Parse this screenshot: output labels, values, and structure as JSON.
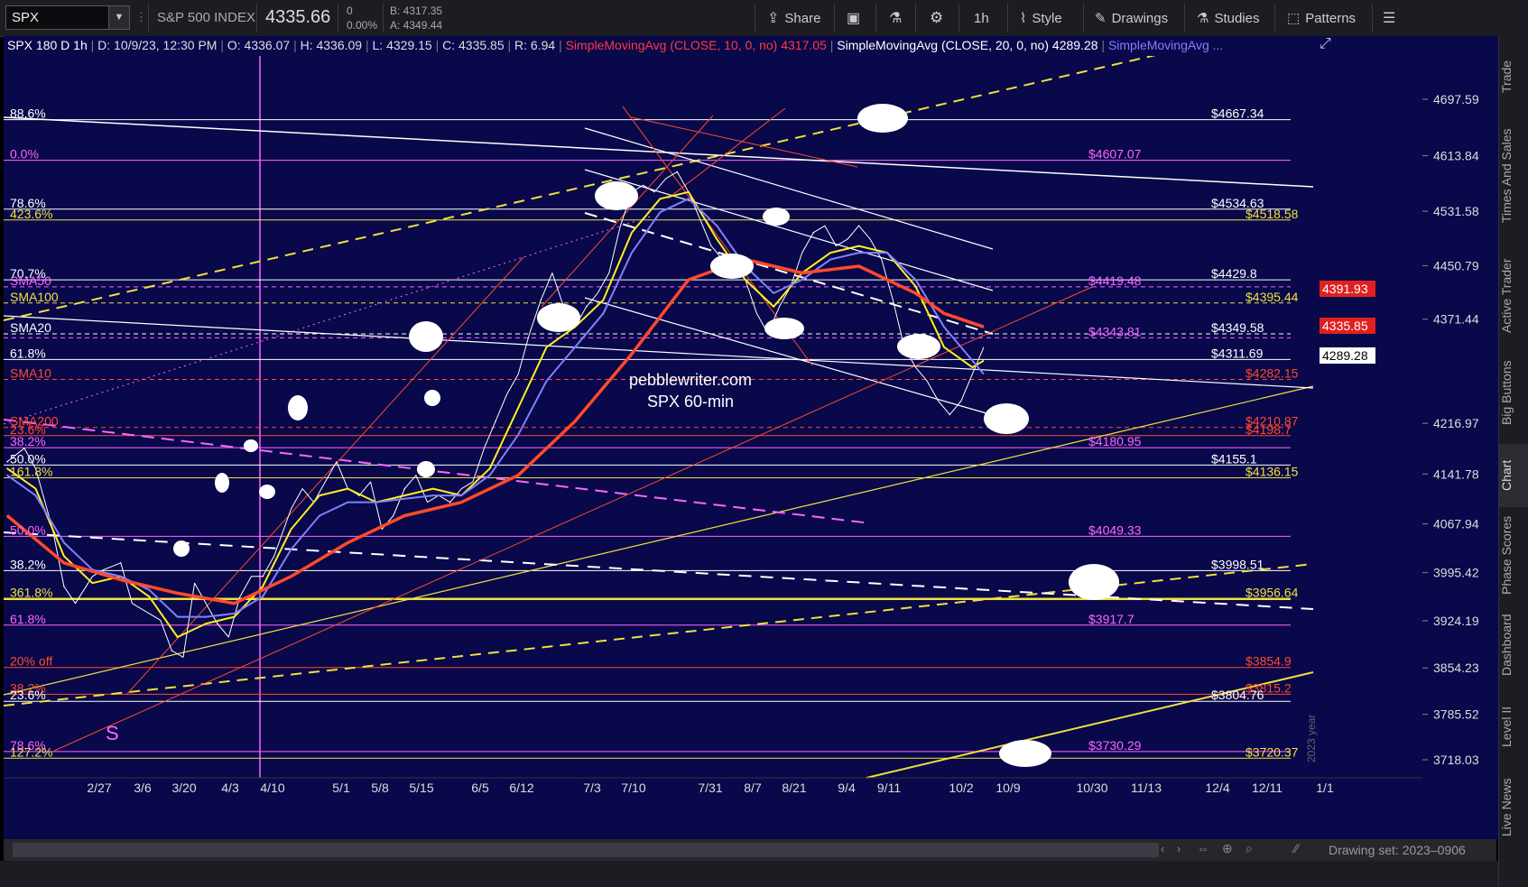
{
  "toolbar": {
    "symbol": "SPX",
    "dropdown": "▼",
    "name": "S&P 500 INDEX",
    "last": "4335.66",
    "change": "0",
    "change_pct": "0.00%",
    "bid": "B: 4317.35",
    "ask": "A: 4349.44",
    "share": "Share",
    "interval": "1h",
    "style": "Style",
    "drawings": "Drawings",
    "studies": "Studies",
    "patterns": "Patterns"
  },
  "infobar": {
    "title": "SPX 180 D 1h",
    "date": "D: 10/9/23, 12:30 PM",
    "open": "O: 4336.07",
    "high": "H: 4336.09",
    "low": "L: 4329.15",
    "close": "C: 4335.85",
    "range": "R: 6.94",
    "sma10": "SimpleMovingAvg (CLOSE, 10, 0, no)",
    "sma10_val": "4317.05",
    "sma20": "SimpleMovingAvg (CLOSE, 20, 0, no)",
    "sma20_val": "4289.28",
    "sma_more": "SimpleMovingAvg ..."
  },
  "right_rail": [
    "Trade",
    "Times And Sales",
    "Active Trader",
    "Big Buttons",
    "Chart",
    "Phase Scores",
    "Dashboard",
    "Level II",
    "Live News"
  ],
  "bottom": {
    "drawing_set": "Drawing set: 2023–0906"
  },
  "watermark": {
    "line1": "pebblewriter.com",
    "line2": "SPX 60-min"
  },
  "year_label": "2023 year",
  "s_marker": "S",
  "colors": {
    "bg": "#08084a",
    "yellow": "#f0e040",
    "magenta": "#ff66ff",
    "red": "#ff4a2a",
    "white": "#ffffff",
    "blue": "#7c7cff"
  },
  "chart_data": {
    "type": "line",
    "title": "SPX 180 D 1h",
    "x_ticks": [
      "2/27",
      "3/6",
      "3/20",
      "4/3",
      "4/10",
      "5/1",
      "5/8",
      "5/15",
      "6/5",
      "6/12",
      "7/3",
      "7/10",
      "7/31",
      "8/7",
      "8/21",
      "9/4",
      "9/11",
      "10/2",
      "10/9",
      "10/30",
      "11/13",
      "12/4",
      "12/11",
      "1/1"
    ],
    "y_ticks": [
      4697.59,
      4613.84,
      4531.58,
      4450.79,
      4371.44,
      4216.97,
      4141.78,
      4067.94,
      3995.42,
      3924.19,
      3854.23,
      3785.52,
      3718.03
    ],
    "ylim": [
      3700,
      4765
    ],
    "price_tags": [
      {
        "value": "4391.93",
        "color": "#e02020"
      },
      {
        "value": "4335.85",
        "color": "#e02020"
      },
      {
        "value": "4289.28",
        "color": "#ffffff"
      }
    ],
    "series": [
      {
        "name": "SPX",
        "color": "#ffffff",
        "points": [
          [
            0,
            4160
          ],
          [
            3,
            4180
          ],
          [
            5,
            4150
          ],
          [
            8,
            4060
          ],
          [
            10,
            3975
          ],
          [
            12,
            3950
          ],
          [
            15,
            3990
          ],
          [
            17,
            4000
          ],
          [
            20,
            4010
          ],
          [
            22,
            3950
          ],
          [
            25,
            3935
          ],
          [
            27,
            3925
          ],
          [
            29,
            3880
          ],
          [
            31,
            3870
          ],
          [
            33,
            3980
          ],
          [
            35,
            3950
          ],
          [
            37,
            3920
          ],
          [
            39,
            3900
          ],
          [
            41,
            3960
          ],
          [
            43,
            3990
          ],
          [
            45,
            3990
          ],
          [
            47,
            4020
          ],
          [
            50,
            4090
          ],
          [
            52,
            4120
          ],
          [
            54,
            4100
          ],
          [
            56,
            4130
          ],
          [
            58,
            4160
          ],
          [
            60,
            4120
          ],
          [
            62,
            4110
          ],
          [
            64,
            4130
          ],
          [
            66,
            4060
          ],
          [
            68,
            4080
          ],
          [
            70,
            4120
          ],
          [
            72,
            4140
          ],
          [
            74,
            4100
          ],
          [
            76,
            4110
          ],
          [
            78,
            4100
          ],
          [
            80,
            4120
          ],
          [
            82,
            4130
          ],
          [
            84,
            4180
          ],
          [
            86,
            4220
          ],
          [
            88,
            4260
          ],
          [
            90,
            4290
          ],
          [
            92,
            4350
          ],
          [
            94,
            4400
          ],
          [
            96,
            4440
          ],
          [
            98,
            4390
          ],
          [
            100,
            4360
          ],
          [
            102,
            4390
          ],
          [
            104,
            4410
          ],
          [
            106,
            4440
          ],
          [
            108,
            4510
          ],
          [
            110,
            4560
          ],
          [
            112,
            4570
          ],
          [
            114,
            4560
          ],
          [
            116,
            4580
          ],
          [
            118,
            4590
          ],
          [
            120,
            4560
          ],
          [
            122,
            4520
          ],
          [
            124,
            4480
          ],
          [
            126,
            4460
          ],
          [
            128,
            4450
          ],
          [
            130,
            4430
          ],
          [
            132,
            4380
          ],
          [
            134,
            4350
          ],
          [
            136,
            4390
          ],
          [
            138,
            4420
          ],
          [
            140,
            4470
          ],
          [
            142,
            4500
          ],
          [
            144,
            4510
          ],
          [
            146,
            4480
          ],
          [
            148,
            4490
          ],
          [
            150,
            4510
          ],
          [
            152,
            4490
          ],
          [
            154,
            4460
          ],
          [
            156,
            4400
          ],
          [
            158,
            4330
          ],
          [
            160,
            4300
          ],
          [
            162,
            4280
          ],
          [
            164,
            4250
          ],
          [
            166,
            4230
          ],
          [
            168,
            4250
          ],
          [
            170,
            4290
          ],
          [
            172,
            4330
          ]
        ]
      },
      {
        "name": "SMA10",
        "color": "#ffee22",
        "points": [
          [
            0,
            4150
          ],
          [
            5,
            4120
          ],
          [
            10,
            4020
          ],
          [
            15,
            3980
          ],
          [
            20,
            3990
          ],
          [
            25,
            3960
          ],
          [
            30,
            3900
          ],
          [
            35,
            3920
          ],
          [
            40,
            3930
          ],
          [
            45,
            3975
          ],
          [
            50,
            4060
          ],
          [
            55,
            4110
          ],
          [
            60,
            4120
          ],
          [
            65,
            4100
          ],
          [
            70,
            4110
          ],
          [
            75,
            4120
          ],
          [
            80,
            4110
          ],
          [
            85,
            4150
          ],
          [
            90,
            4240
          ],
          [
            95,
            4330
          ],
          [
            100,
            4360
          ],
          [
            105,
            4400
          ],
          [
            110,
            4500
          ],
          [
            115,
            4550
          ],
          [
            120,
            4560
          ],
          [
            125,
            4490
          ],
          [
            130,
            4430
          ],
          [
            135,
            4390
          ],
          [
            140,
            4440
          ],
          [
            145,
            4470
          ],
          [
            150,
            4480
          ],
          [
            155,
            4470
          ],
          [
            160,
            4420
          ],
          [
            165,
            4330
          ],
          [
            170,
            4300
          ],
          [
            172,
            4310
          ]
        ]
      },
      {
        "name": "SMA20",
        "color": "#8080ff",
        "points": [
          [
            0,
            4140
          ],
          [
            5,
            4110
          ],
          [
            10,
            4040
          ],
          [
            15,
            4000
          ],
          [
            20,
            3990
          ],
          [
            25,
            3970
          ],
          [
            30,
            3930
          ],
          [
            35,
            3930
          ],
          [
            40,
            3935
          ],
          [
            45,
            3960
          ],
          [
            50,
            4030
          ],
          [
            55,
            4080
          ],
          [
            60,
            4100
          ],
          [
            65,
            4100
          ],
          [
            70,
            4105
          ],
          [
            75,
            4110
          ],
          [
            80,
            4110
          ],
          [
            85,
            4140
          ],
          [
            90,
            4200
          ],
          [
            95,
            4280
          ],
          [
            100,
            4330
          ],
          [
            105,
            4380
          ],
          [
            110,
            4470
          ],
          [
            115,
            4530
          ],
          [
            120,
            4550
          ],
          [
            125,
            4510
          ],
          [
            130,
            4450
          ],
          [
            135,
            4410
          ],
          [
            140,
            4430
          ],
          [
            145,
            4460
          ],
          [
            150,
            4470
          ],
          [
            155,
            4470
          ],
          [
            160,
            4430
          ],
          [
            165,
            4360
          ],
          [
            170,
            4310
          ],
          [
            172,
            4290
          ]
        ]
      },
      {
        "name": "SMA50",
        "color": "#ff4a2a",
        "points": [
          [
            0,
            4080
          ],
          [
            10,
            4010
          ],
          [
            20,
            3985
          ],
          [
            30,
            3965
          ],
          [
            40,
            3950
          ],
          [
            50,
            3990
          ],
          [
            60,
            4040
          ],
          [
            70,
            4080
          ],
          [
            80,
            4100
          ],
          [
            90,
            4140
          ],
          [
            100,
            4220
          ],
          [
            110,
            4320
          ],
          [
            120,
            4430
          ],
          [
            130,
            4460
          ],
          [
            140,
            4440
          ],
          [
            150,
            4450
          ],
          [
            160,
            4410
          ],
          [
            165,
            4380
          ],
          [
            172,
            4360
          ]
        ]
      }
    ],
    "levels": [
      {
        "left": "88.6%",
        "right": "$4667.34",
        "value": 4667.34,
        "color": "#ffffff",
        "dash": false
      },
      {
        "left": "0.0%",
        "right": "$4607.07",
        "value": 4607.07,
        "color": "#ff66ff",
        "dash": false
      },
      {
        "left": "78.6%",
        "right": "$4534.63",
        "value": 4534.63,
        "color": "#ffffff",
        "dash": false
      },
      {
        "left": "423.6%",
        "right": "$4518.58",
        "value": 4518.58,
        "color": "#f0e040",
        "dash": false
      },
      {
        "left": "70.7%",
        "right": "$4429.8",
        "value": 4429.8,
        "color": "#ffffff",
        "dash": false
      },
      {
        "left": "SMA50",
        "right": "$4419.48",
        "value": 4419.48,
        "color": "#ff66ff",
        "dash": true
      },
      {
        "left": "SMA100",
        "right": "$4395.44",
        "value": 4395.44,
        "color": "#f0e040",
        "dash": true
      },
      {
        "left": "SMA20",
        "right": "$4349.58",
        "value": 4349.58,
        "color": "#ffffff",
        "dash": true
      },
      {
        "left": "",
        "right": "$4343.81",
        "value": 4343.81,
        "color": "#ff66ff",
        "dash": true
      },
      {
        "left": "61.8%",
        "right": "$4311.69",
        "value": 4311.69,
        "color": "#ffffff",
        "dash": false
      },
      {
        "left": "SMA10",
        "right": "$4282.15",
        "value": 4282.15,
        "color": "#ff4a2a",
        "dash": true
      },
      {
        "left": "SMA200",
        "right": "$4210.87",
        "value": 4210.87,
        "color": "#ff4a2a",
        "dash": true
      },
      {
        "left": "23.6%",
        "right": "$4198.7",
        "value": 4198.7,
        "color": "#ff4a2a",
        "dash": false
      },
      {
        "left": "38.2%",
        "right": "$4180.95",
        "value": 4180.95,
        "color": "#ff66ff",
        "dash": false
      },
      {
        "left": "50.0%",
        "right": "$4155.1",
        "value": 4155.1,
        "color": "#ffffff",
        "dash": false
      },
      {
        "left": "161.8%",
        "right": "$4136.15",
        "value": 4136.15,
        "color": "#f0e040",
        "dash": false
      },
      {
        "left": "50.0%",
        "right": "$4049.33",
        "value": 4049.33,
        "color": "#ff66ff",
        "dash": false
      },
      {
        "left": "38.2%",
        "right": "$3998.51",
        "value": 3998.51,
        "color": "#ffffff",
        "dash": false
      },
      {
        "left": "361.8%",
        "right": "$3956.64",
        "value": 3956.64,
        "color": "#f0e040",
        "dash": false
      },
      {
        "left": "61.8%",
        "right": "$3917.7",
        "value": 3917.7,
        "color": "#ff66ff",
        "dash": false
      },
      {
        "left": "20% off",
        "right": "$3854.9",
        "value": 3854.9,
        "color": "#ff4a2a",
        "dash": false
      },
      {
        "left": "38.2%",
        "right": "$3815.2",
        "value": 3815.2,
        "color": "#ff4a2a",
        "dash": false
      },
      {
        "left": "23.6%",
        "right": "$3804.76",
        "value": 3804.76,
        "color": "#ffffff",
        "dash": false
      },
      {
        "left": "78.6%",
        "right": "$3730.29",
        "value": 3730.29,
        "color": "#ff66ff",
        "dash": false
      },
      {
        "left": "127.2%",
        "right": "$3720.37",
        "value": 3720.37,
        "color": "#f0e040",
        "dash": false
      }
    ]
  }
}
